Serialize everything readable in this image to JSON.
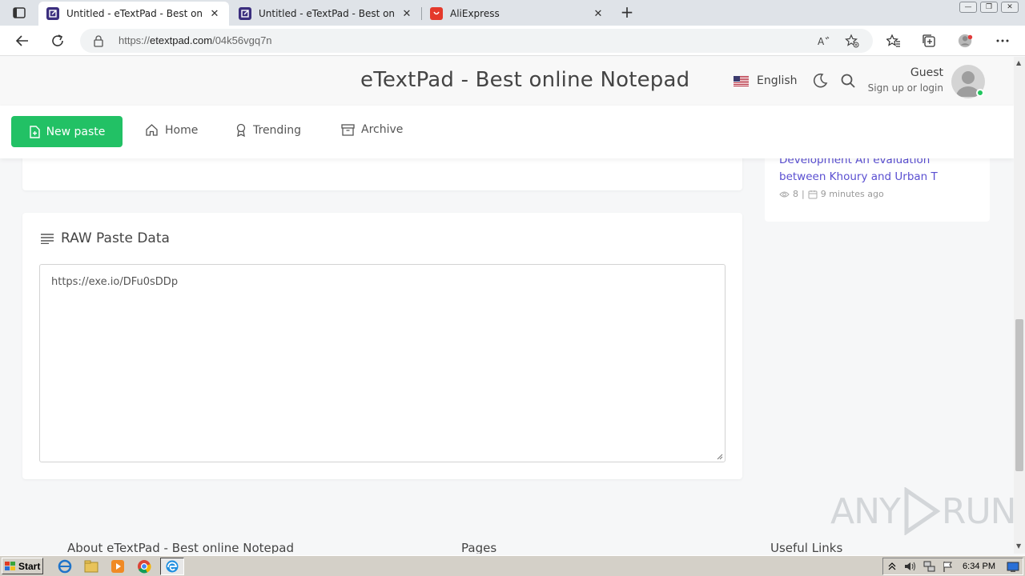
{
  "browser": {
    "tabs": [
      {
        "title": "Untitled - eTextPad - Best online Notepad",
        "active": true
      },
      {
        "title": "Untitled - eTextPad - Best online Notepad",
        "active": false
      },
      {
        "title": "AliExpress",
        "active": false
      }
    ],
    "close_glyph": "✕",
    "new_tab_glyph": "+",
    "url_prefix": "https://",
    "url_domain": "etextpad.com",
    "url_path": "/04k56vgq7n"
  },
  "header": {
    "site_title": "eTextPad - Best online Notepad",
    "language": "English",
    "user_name": "Guest",
    "user_action": "Sign up or login"
  },
  "nav": {
    "new_paste": "New paste",
    "home": "Home",
    "trending": "Trending",
    "archive": "Archive"
  },
  "raw": {
    "heading": "RAW Paste Data",
    "content": "https://exe.io/DFu0sDDp"
  },
  "sidebar": {
    "item_title": "Development An evaluation between Khoury and Urban T",
    "views": "8",
    "separator": "|",
    "time_ago": "9 minutes ago"
  },
  "watermark": {
    "left": "ANY",
    "right": "RUN"
  },
  "footer": {
    "about": "About eTextPad - Best online Notepad",
    "pages": "Pages",
    "links": "Useful Links"
  },
  "taskbar": {
    "start": "Start",
    "time": "6:34 PM"
  },
  "colors": {
    "accent_green": "#22c165",
    "link_purple": "#5a4fd1",
    "online_dot": "#22c55e"
  }
}
